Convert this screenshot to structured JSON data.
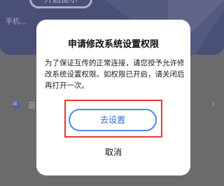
{
  "background": {
    "card_button_label": "开启提示",
    "card_subtext": "手机...",
    "row_label": "最...",
    "row_chevron": "›"
  },
  "dialog": {
    "title": "申请修改系统设置权限",
    "message": "为了保证互传的正常连接，请您授予允许修改系统设置权限。如权限已开启，请关闭后再打开一次。",
    "confirm_label": "去设置",
    "cancel_label": "取消"
  },
  "colors": {
    "overlay": "#6b6b6e",
    "card": "#4a4f78",
    "accent": "#2f6fd6",
    "highlight": "#e5383b"
  }
}
